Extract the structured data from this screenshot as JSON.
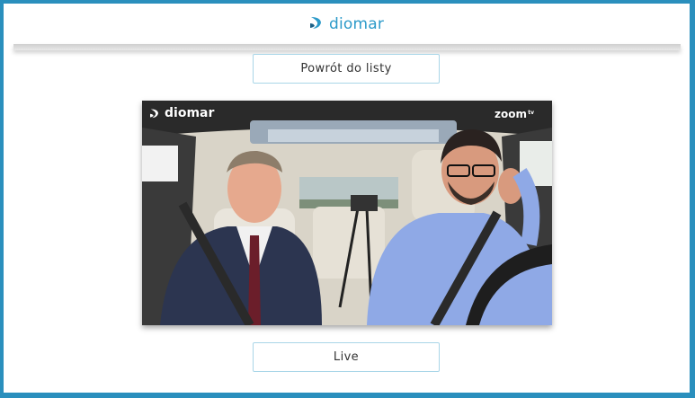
{
  "header": {
    "brand_name": "diomar",
    "logo_icon": "diomar-swoosh-icon",
    "accent_color": "#2c9ac9"
  },
  "buttons": {
    "back_label": "Powrót do listy",
    "live_label": "Live"
  },
  "video": {
    "watermark_brand": "diomar",
    "watermark_channel": "zoom",
    "watermark_channel_suffix": "tv"
  },
  "colors": {
    "border": "#2a8fbd",
    "button_border": "#a9d6e8"
  }
}
